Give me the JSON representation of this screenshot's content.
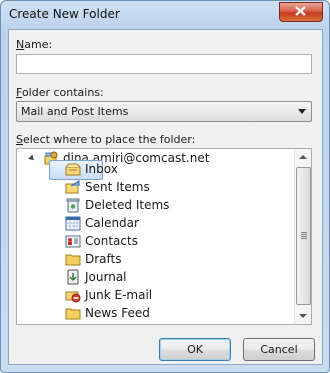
{
  "window": {
    "title": "Create New Folder"
  },
  "name": {
    "label_u": "N",
    "label_rest": "ame:",
    "value": ""
  },
  "contains": {
    "label_u": "F",
    "label_rest": "older contains:",
    "selected": "Mail and Post Items"
  },
  "location": {
    "label_u": "S",
    "label_rest": "elect where to place the folder:"
  },
  "tree": {
    "account": "dina.amiri@comcast.net",
    "items": [
      "Inbox",
      "Sent Items",
      "Deleted Items",
      "Calendar",
      "Contacts",
      "Drafts",
      "Journal",
      "Junk E-mail",
      "News Feed"
    ]
  },
  "buttons": {
    "ok": "OK",
    "cancel": "Cancel"
  },
  "colors": {
    "accent": "#7da2ce",
    "close": "#c43b20"
  }
}
